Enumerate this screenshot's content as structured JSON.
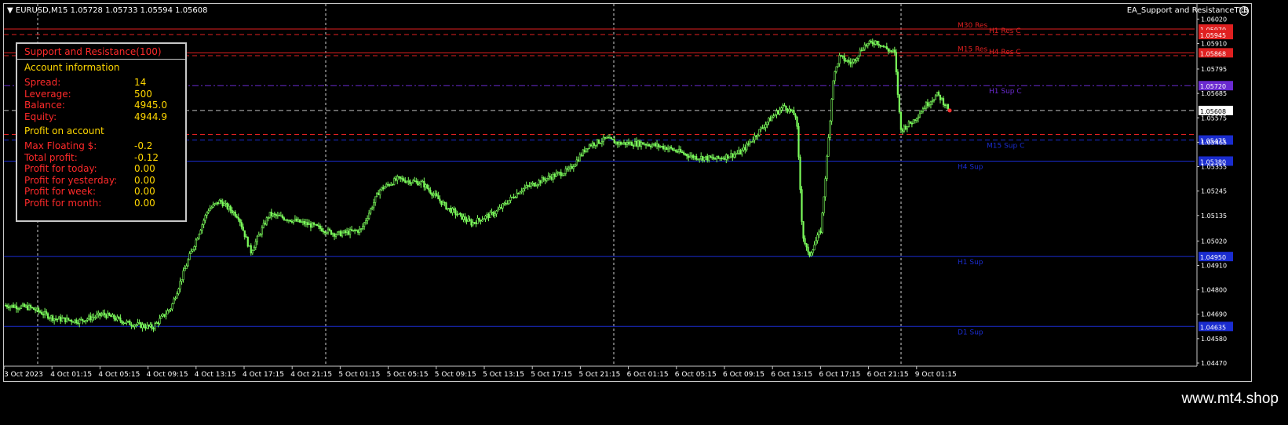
{
  "header": {
    "symbol": "EURUSD,M15",
    "ohlc": "1.05728 1.05733 1.05594 1.05608",
    "ea_name": "EA_Support and ResistanceTLB"
  },
  "panel": {
    "title": "Support and Resistance(100)",
    "account_heading": "Account information",
    "account_rows": [
      {
        "label": "Spread:",
        "value": "14"
      },
      {
        "label": "Leverage:",
        "value": "500"
      },
      {
        "label": "Balance:",
        "value": "4945.0"
      },
      {
        "label": "Equity:",
        "value": "4944.9"
      }
    ],
    "profit_heading": "Profit on account",
    "profit_rows": [
      {
        "label": "Max Floating $:",
        "value": "-0.2"
      },
      {
        "label": "Total profit:",
        "value": "-0.12"
      },
      {
        "label": "Profit for today:",
        "value": "0.00"
      },
      {
        "label": "Profit for yesterday:",
        "value": "0.00"
      },
      {
        "label": "Profit for week:",
        "value": "0.00"
      },
      {
        "label": "Profit for month:",
        "value": "0.00"
      }
    ]
  },
  "watermark": "www.mt4.shop",
  "colors": {
    "background": "#000000",
    "candle": "#7cfc5c",
    "resistance": "#e02020",
    "support": "#1a2ccf",
    "panel_label": "#ff2a2a",
    "panel_value": "#ffd700"
  },
  "chart_data": {
    "type": "candlestick",
    "symbol": "EURUSD",
    "timeframe": "M15",
    "ylim": [
      1.0447,
      1.0606
    ],
    "y_ticks": [
      "1.06020",
      "1.05910",
      "1.05795",
      "1.05685",
      "1.05575",
      "1.05465",
      "1.05355",
      "1.05245",
      "1.05135",
      "1.05020",
      "1.04910",
      "1.04800",
      "1.04690",
      "1.04580",
      "1.04470"
    ],
    "current_price": "1.05608",
    "x_ticks": [
      "3 Oct 2023",
      "4 Oct 01:15",
      "4 Oct 05:15",
      "4 Oct 09:15",
      "4 Oct 13:15",
      "4 Oct 17:15",
      "4 Oct 21:15",
      "5 Oct 01:15",
      "5 Oct 05:15",
      "5 Oct 09:15",
      "5 Oct 13:15",
      "5 Oct 17:15",
      "5 Oct 21:15",
      "6 Oct 01:15",
      "6 Oct 05:15",
      "6 Oct 09:15",
      "6 Oct 13:15",
      "6 Oct 17:15",
      "6 Oct 21:15",
      "9 Oct 01:15"
    ],
    "close_path": [
      [
        0,
        1.0473
      ],
      [
        0.02,
        1.0472
      ],
      [
        0.04,
        1.0467
      ],
      [
        0.06,
        1.0466
      ],
      [
        0.08,
        1.0469
      ],
      [
        0.1,
        1.0465
      ],
      [
        0.12,
        1.0463
      ],
      [
        0.135,
        1.0472
      ],
      [
        0.15,
        1.0495
      ],
      [
        0.165,
        1.0516
      ],
      [
        0.175,
        1.052
      ],
      [
        0.19,
        1.0513
      ],
      [
        0.2,
        1.0497
      ],
      [
        0.215,
        1.0514
      ],
      [
        0.23,
        1.0512
      ],
      [
        0.25,
        1.0509
      ],
      [
        0.27,
        1.0505
      ],
      [
        0.29,
        1.0507
      ],
      [
        0.305,
        1.0525
      ],
      [
        0.32,
        1.053
      ],
      [
        0.34,
        1.0528
      ],
      [
        0.36,
        1.0517
      ],
      [
        0.38,
        1.051
      ],
      [
        0.4,
        1.0515
      ],
      [
        0.42,
        1.0525
      ],
      [
        0.44,
        1.053
      ],
      [
        0.46,
        1.0534
      ],
      [
        0.475,
        1.0545
      ],
      [
        0.49,
        1.0548
      ],
      [
        0.5,
        1.0546
      ],
      [
        0.52,
        1.0546
      ],
      [
        0.54,
        1.0544
      ],
      [
        0.56,
        1.054
      ],
      [
        0.58,
        1.0539
      ],
      [
        0.6,
        1.0542
      ],
      [
        0.62,
        1.0555
      ],
      [
        0.635,
        1.0563
      ],
      [
        0.645,
        1.0558
      ],
      [
        0.65,
        1.0505
      ],
      [
        0.655,
        1.0495
      ],
      [
        0.665,
        1.0507
      ],
      [
        0.67,
        1.054
      ],
      [
        0.675,
        1.0575
      ],
      [
        0.68,
        1.0585
      ],
      [
        0.69,
        1.0582
      ],
      [
        0.7,
        1.059
      ],
      [
        0.71,
        1.0592
      ],
      [
        0.72,
        1.0588
      ],
      [
        0.725,
        1.0587
      ],
      [
        0.73,
        1.0552
      ],
      [
        0.74,
        1.0556
      ],
      [
        0.75,
        1.0563
      ],
      [
        0.76,
        1.0568
      ],
      [
        0.77,
        1.0561
      ]
    ],
    "levels": [
      {
        "label": "M30 Res",
        "price": 1.05975,
        "color": "#e02020",
        "style": "solid",
        "tag": "1.05970"
      },
      {
        "label": "H1 Res C",
        "price": 1.0595,
        "color": "#e02020",
        "style": "dash",
        "tag": "1.05945"
      },
      {
        "label": "M15 Res",
        "price": 1.05868,
        "color": "#e02020",
        "style": "solid",
        "tag": "1.05868"
      },
      {
        "label": "H4 Res C",
        "price": 1.05855,
        "color": "#e02020",
        "style": "dash",
        "tag": ""
      },
      {
        "label": "H1 Sup C",
        "price": 1.0572,
        "color": "#6a2ad0",
        "style": "dashdot",
        "tag": "1.05720"
      },
      {
        "label": "",
        "price": 1.05608,
        "color": "#c0c0c0",
        "style": "dash",
        "tag": ""
      },
      {
        "label": "",
        "price": 1.055,
        "color": "#e02020",
        "style": "dash",
        "tag": ""
      },
      {
        "label": "M15 Sup C",
        "price": 1.05475,
        "color": "#1a2ccf",
        "style": "dash",
        "tag": "1.05475"
      },
      {
        "label": "H4 Sup",
        "price": 1.0538,
        "color": "#1a2ccf",
        "style": "solid",
        "tag": "1.05380"
      },
      {
        "label": "H1 Sup",
        "price": 1.0495,
        "color": "#1a2ccf",
        "style": "solid",
        "tag": "1.04950"
      },
      {
        "label": "D1 Sup",
        "price": 1.04635,
        "color": "#1a2ccf",
        "style": "solid",
        "tag": "1.04635"
      }
    ],
    "grid_x_ticks_index": [
      0,
      6,
      12,
      18
    ]
  }
}
